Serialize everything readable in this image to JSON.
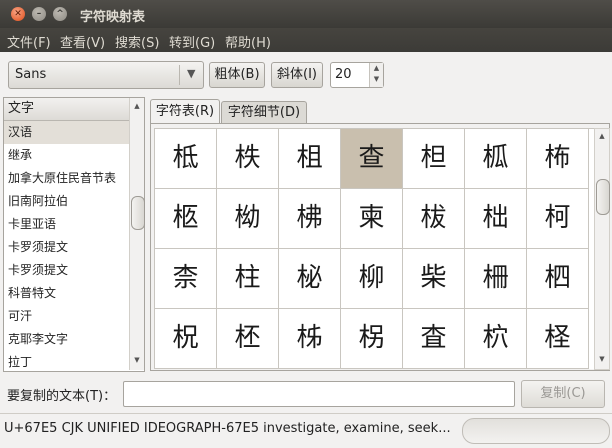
{
  "window": {
    "title": "字符映射表"
  },
  "menu": [
    "文件(F)",
    "查看(V)",
    "搜索(S)",
    "转到(G)",
    "帮助(H)"
  ],
  "toolbar": {
    "font": "Sans",
    "bold_label": "粗体(B)",
    "italic_label": "斜体(I)",
    "size": "20"
  },
  "sidebar": {
    "header": "文字",
    "items": [
      "汉语",
      "继承",
      "加拿大原住民音节表",
      "旧南阿拉伯",
      "卡里亚语",
      "卡罗须提文",
      "卡罗须提文",
      "科普特文",
      "可汗",
      "克耶李文字",
      "拉丁"
    ],
    "selected_index": 0
  },
  "tabs": [
    "字符表(R)",
    "字符细节(D)"
  ],
  "grid": {
    "rows": [
      [
        "柢",
        "柣",
        "柤",
        "查",
        "柦",
        "柧",
        "柨"
      ],
      [
        "柩",
        "柪",
        "柫",
        "柬",
        "柭",
        "柮",
        "柯"
      ],
      [
        "柰",
        "柱",
        "柲",
        "柳",
        "柴",
        "柵",
        "柶"
      ],
      [
        "柷",
        "柸",
        "柹",
        "柺",
        "査",
        "柼",
        "柽"
      ]
    ],
    "selected": [
      0,
      3
    ]
  },
  "copy": {
    "label": "要复制的文本(T)：",
    "value": "",
    "button": "复制(C)"
  },
  "status": "U+67E5 CJK UNIFIED IDEOGRAPH-67E5   investigate, examine, seek..."
}
